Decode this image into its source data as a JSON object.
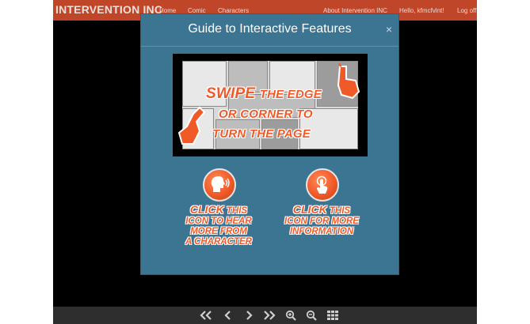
{
  "nav": {
    "brand": "INTERVENTION INC",
    "home": "Home",
    "comic": "Comic",
    "characters": "Characters",
    "about": "About Intervention INC",
    "greeting": "Hello, kfmcfvlnt!",
    "logoff": "Log off"
  },
  "modal": {
    "title": "Guide to Interactive Features",
    "close": "×",
    "swipe_line1_a": "SWIPE",
    "swipe_line1_b": "THE EDGE",
    "swipe_line2": "OR CORNER TO",
    "swipe_line3": "TURN THE PAGE",
    "hear_line1_a": "CLICK",
    "hear_line1_b": "THIS",
    "hear_line2": "ICON TO HEAR",
    "hear_line3": "MORE FROM",
    "hear_line4": "A CHARACTER",
    "info_line1_a": "CLICK",
    "info_line1_b": "THIS",
    "info_line2": "ICON FOR MORE",
    "info_line3": "INFORMATION"
  },
  "icons": {
    "first": "double-chevron-left-icon",
    "prev": "chevron-left-icon",
    "next": "chevron-right-icon",
    "last": "double-chevron-right-icon",
    "zoom_in": "zoom-in-icon",
    "zoom_out": "zoom-out-icon",
    "grid": "grid-icon"
  },
  "colors": {
    "nav_bg": "#c0462a",
    "modal_bg": "#3c7592",
    "accent_orange": "#f05a28",
    "toolbar_bg": "#2e2e2e"
  }
}
